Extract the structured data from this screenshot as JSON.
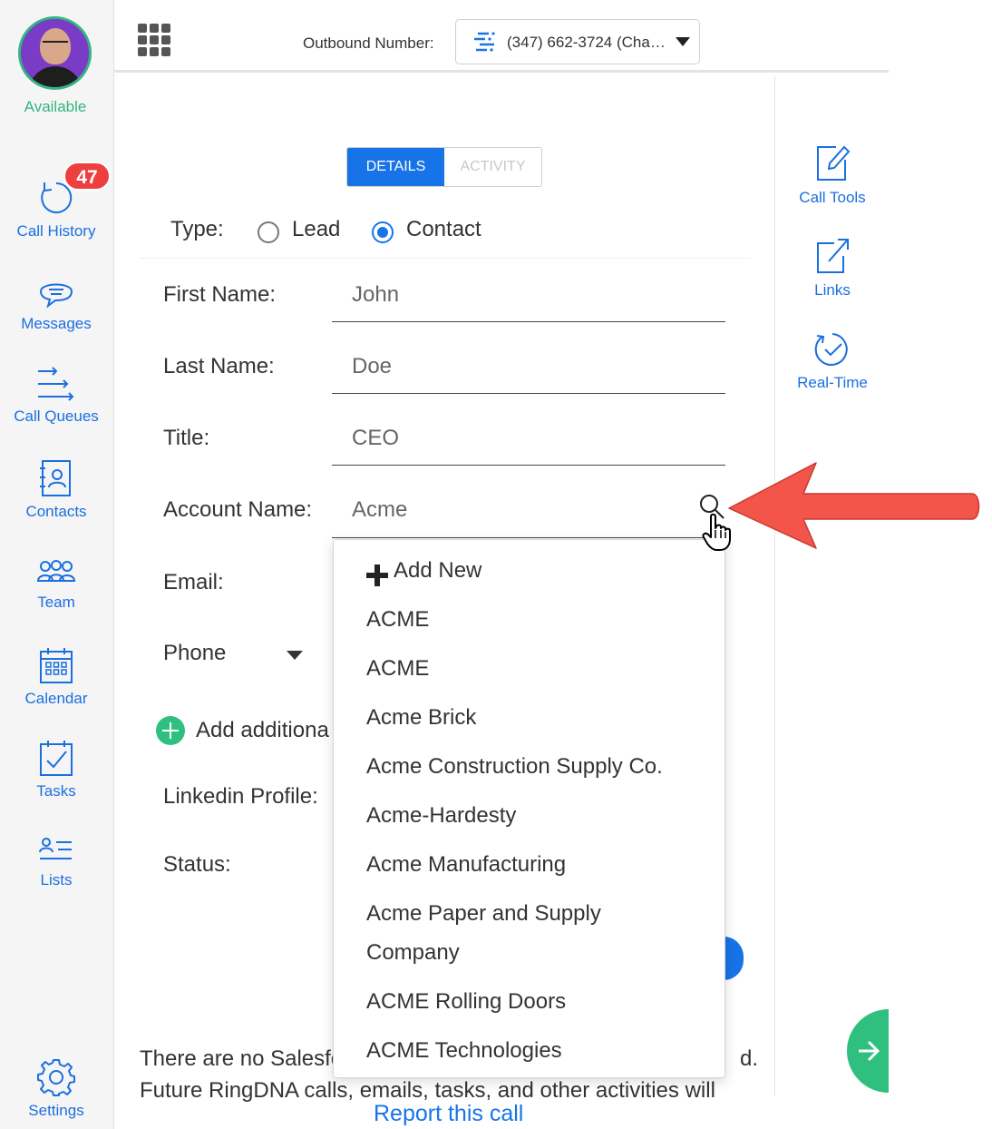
{
  "user": {
    "status": "Available"
  },
  "nav": {
    "call_history": {
      "label": "Call History",
      "badge": "47"
    },
    "messages": {
      "label": "Messages"
    },
    "call_queues": {
      "label": "Call Queues"
    },
    "contacts": {
      "label": "Contacts"
    },
    "team": {
      "label": "Team"
    },
    "calendar": {
      "label": "Calendar"
    },
    "tasks": {
      "label": "Tasks"
    },
    "lists": {
      "label": "Lists"
    },
    "settings": {
      "label": "Settings"
    }
  },
  "header": {
    "outbound_label": "Outbound Number:",
    "outbound_value": "(347) 662-3724 (Cha…"
  },
  "tabs": {
    "details": "DETAILS",
    "activity": "ACTIVITY"
  },
  "form": {
    "type_label": "Type:",
    "type_options": {
      "lead": "Lead",
      "contact": "Contact"
    },
    "first_name_label": "First Name:",
    "first_name_value": "John",
    "last_name_label": "Last Name:",
    "last_name_value": "Doe",
    "title_label": "Title:",
    "title_value": "CEO",
    "account_name_label": "Account Name:",
    "account_name_value": "Acme",
    "email_label": "Email:",
    "phone_label": "Phone",
    "add_additional_label": "Add additiona",
    "linkedin_label": "Linkedin Profile:",
    "status_label": "Status:"
  },
  "dropdown": {
    "add_new": "Add New",
    "items": [
      "ACME",
      "ACME",
      "Acme Brick",
      "Acme Construction Supply Co.",
      "Acme-Hardesty",
      "Acme Manufacturing",
      "Acme Paper and Supply",
      "Company",
      "ACME Rolling Doors",
      "ACME Technologies"
    ]
  },
  "footer": {
    "line1": "There are no Salesfo",
    "line1_end": "d.",
    "line2": "Future RingDNA calls, emails, tasks, and other activities will",
    "report_link": "Report this call"
  },
  "rail": {
    "call_tools": "Call Tools",
    "links": "Links",
    "real_time": "Real-Time"
  },
  "colors": {
    "accent": "#1774e8",
    "green": "#2fc07f",
    "badge": "#ee3f3f",
    "arrow": "#f4554a"
  }
}
